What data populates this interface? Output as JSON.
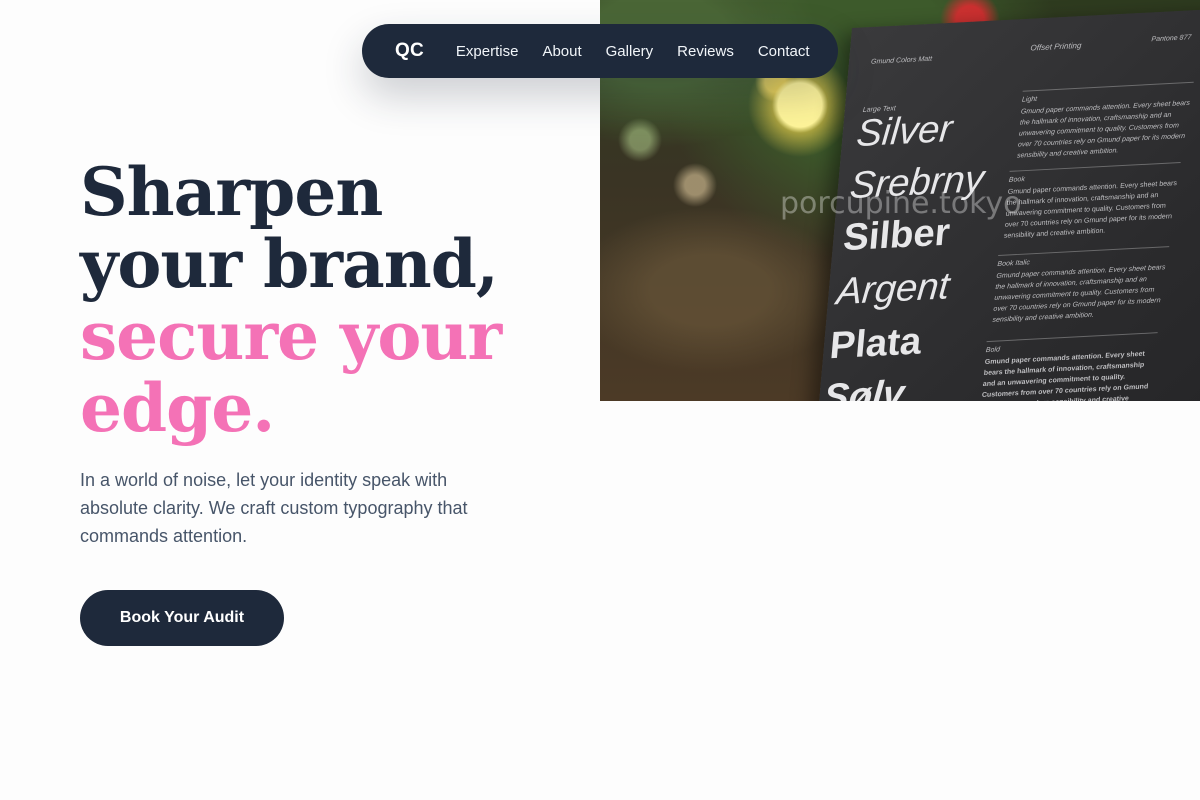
{
  "nav": {
    "logo": "QC",
    "links": [
      "Expertise",
      "About",
      "Gallery",
      "Reviews",
      "Contact"
    ]
  },
  "hero": {
    "headline_dark_1": "Sharpen",
    "headline_dark_2": "your brand,",
    "headline_pink_1": "secure your",
    "headline_pink_2": "edge.",
    "subtext": "In a world of noise, let your identity speak with absolute clarity. We craft custom typography that commands attention.",
    "cta_label": "Book Your Audit"
  },
  "photo": {
    "watermark": "porcupine.tokyo",
    "card_header_left": "Gmund Colors Matt",
    "card_header_mid": "Offset Printing",
    "card_header_right": "Pantone 877",
    "card_words": [
      "Silver",
      "Srebrny",
      "Silber",
      "Argent",
      "Plata",
      "Sølv"
    ],
    "card_labels": [
      "Large Text",
      "Light",
      "Book",
      "Book Italic",
      "Bold"
    ],
    "card_body": "Gmund paper commands attention. Every sheet bears the hallmark of innovation, craftsmanship and an unwavering commitment to quality. Customers from over 70 countries rely on Gmund paper for its modern sensibility and creative ambition."
  },
  "colors": {
    "navy": "#1e293b",
    "pink": "#f472b6",
    "slate": "#475569",
    "background": "#fdfdfd"
  }
}
